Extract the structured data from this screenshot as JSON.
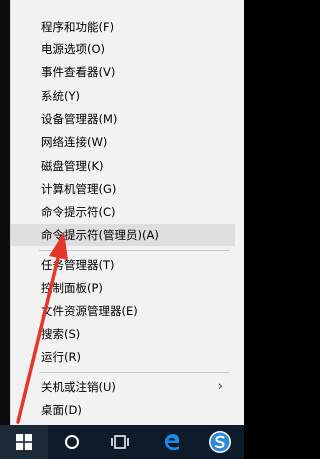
{
  "menu": {
    "items": [
      {
        "label": "程序和功能(F)"
      },
      {
        "label": "电源选项(O)"
      },
      {
        "label": "事件查看器(V)"
      },
      {
        "label": "系统(Y)"
      },
      {
        "label": "设备管理器(M)"
      },
      {
        "label": "网络连接(W)"
      },
      {
        "label": "磁盘管理(K)"
      },
      {
        "label": "计算机管理(G)"
      },
      {
        "label": "命令提示符(C)"
      },
      {
        "label": "命令提示符(管理员)(A)"
      },
      {
        "label": "任务管理器(T)"
      },
      {
        "label": "控制面板(P)"
      },
      {
        "label": "文件资源管理器(E)"
      },
      {
        "label": "搜索(S)"
      },
      {
        "label": "运行(R)"
      },
      {
        "label": "关机或注销(U)"
      },
      {
        "label": "桌面(D)"
      }
    ],
    "highlighted_item": "命令提示符(管理员)(A)",
    "submenu_arrow_glyph": "›"
  },
  "taskbar": {
    "buttons": [
      {
        "icon": "windows-logo-icon"
      },
      {
        "icon": "cortana-circle-icon"
      },
      {
        "icon": "task-view-icon"
      },
      {
        "icon": "edge-browser-icon"
      },
      {
        "icon": "sogou-search-icon"
      }
    ]
  },
  "colors": {
    "menu_bg": "#f2f2f2",
    "highlight": "#dedede",
    "taskbar": "#0d1b2a",
    "annotation_arrow": "#e8352b",
    "edge_blue": "#1e88e5"
  }
}
